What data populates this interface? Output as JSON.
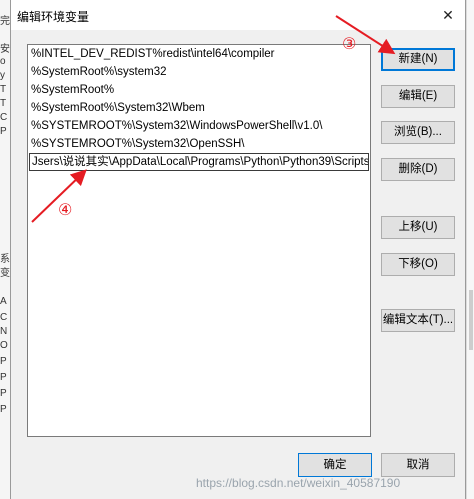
{
  "window": {
    "title": "编辑环境变量",
    "close_glyph": "✕"
  },
  "background": {
    "left_fragments": [
      "完",
      "安",
      "o",
      "y",
      "T",
      "T",
      "C",
      "P",
      "系",
      "变",
      "A",
      "C",
      "N",
      "O",
      "P",
      "P",
      "P",
      "P"
    ]
  },
  "path_list": [
    "%INTEL_DEV_REDIST%redist\\intel64\\compiler",
    "%SystemRoot%\\system32",
    "%SystemRoot%",
    "%SystemRoot%\\System32\\Wbem",
    "%SYSTEMROOT%\\System32\\WindowsPowerShell\\v1.0\\",
    "%SYSTEMROOT%\\System32\\OpenSSH\\",
    "Jsers\\说说其实\\AppData\\Local\\Programs\\Python\\Python39\\Scripts"
  ],
  "buttons": {
    "new": "新建(N)",
    "edit": "编辑(E)",
    "browse": "浏览(B)...",
    "delete": "删除(D)",
    "move_up": "上移(U)",
    "move_down": "下移(O)",
    "edit_text": "编辑文本(T)...",
    "ok": "确定",
    "cancel": "取消"
  },
  "annotations": {
    "step3": "③",
    "step4": "④",
    "color": "#e51c23"
  },
  "watermark": "https://blog.csdn.net/weixin_40587190"
}
